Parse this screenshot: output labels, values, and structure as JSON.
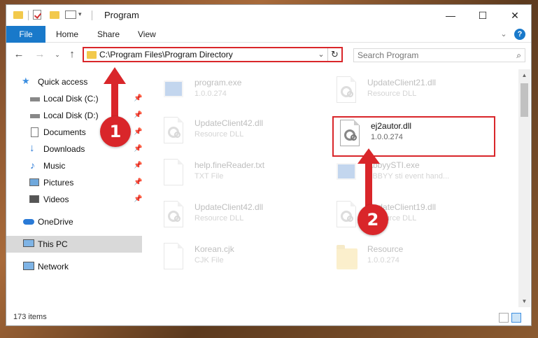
{
  "window": {
    "title": "Program",
    "controls": {
      "minimize": "—",
      "maximize": "☐",
      "close": "✕"
    }
  },
  "ribbon": {
    "tabs": [
      "File",
      "Home",
      "Share",
      "View"
    ],
    "help": "?"
  },
  "address_bar": {
    "path": "C:\\Program Files\\Program Directory",
    "search_placeholder": "Search Program"
  },
  "sidebar": {
    "quick_access": "Quick access",
    "items": [
      {
        "label": "Local Disk (C:)",
        "icon": "drive-icon",
        "pinned": true
      },
      {
        "label": "Local Disk (D:)",
        "icon": "drive-icon",
        "pinned": true
      },
      {
        "label": "Documents",
        "icon": "documents-icon",
        "pinned": true
      },
      {
        "label": "Downloads",
        "icon": "downloads-icon",
        "pinned": true
      },
      {
        "label": "Music",
        "icon": "music-icon",
        "pinned": true
      },
      {
        "label": "Pictures",
        "icon": "pictures-icon",
        "pinned": true
      },
      {
        "label": "Videos",
        "icon": "videos-icon",
        "pinned": true
      }
    ],
    "onedrive": "OneDrive",
    "this_pc": "This PC",
    "network": "Network"
  },
  "files": [
    {
      "name": "program.exe",
      "sub": "1.0.0.274",
      "icon": "exe-icon",
      "highlighted": false
    },
    {
      "name": "UpdateClient21.dll",
      "sub": "Resource DLL",
      "icon": "dll-icon",
      "highlighted": false
    },
    {
      "name": "UpdateClient42.dll",
      "sub": "Resource DLL",
      "icon": "dll-icon",
      "highlighted": false
    },
    {
      "name": "ej2autor.dll",
      "sub": "1.0.0.274",
      "icon": "dll-icon",
      "highlighted": true
    },
    {
      "name": "help.fineReader.txt",
      "sub": "TXT File",
      "icon": "txt-icon",
      "highlighted": false
    },
    {
      "name": "AbbyySTI.exe",
      "sub": "ABBYY sti event hand...",
      "icon": "exe-icon",
      "highlighted": false
    },
    {
      "name": "UpdateClient42.dll",
      "sub": "Resource DLL",
      "icon": "dll-icon",
      "highlighted": false
    },
    {
      "name": "UpdateClient19.dll",
      "sub": "Resource DLL",
      "icon": "dll-icon",
      "highlighted": false
    },
    {
      "name": "Korean.cjk",
      "sub": "CJK File",
      "icon": "file-icon",
      "highlighted": false
    },
    {
      "name": "Resource",
      "sub": "1.0.0.274",
      "icon": "folder-icon",
      "highlighted": false
    }
  ],
  "status": {
    "count": "173 items"
  },
  "annotations": {
    "step1": "1",
    "step2": "2",
    "color": "#d9262a"
  }
}
